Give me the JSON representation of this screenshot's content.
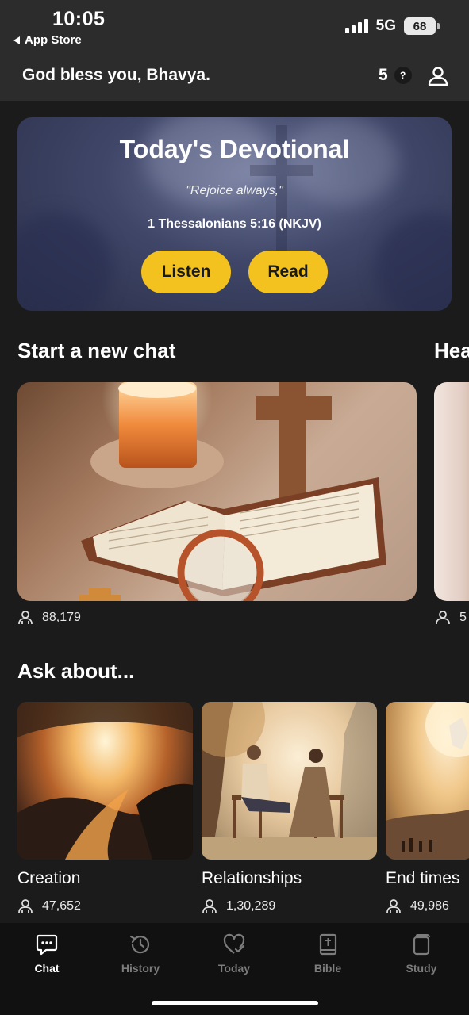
{
  "status_bar": {
    "time": "10:05",
    "back_label": "App Store",
    "network": "5G",
    "battery": "68"
  },
  "header": {
    "greeting": "God bless you, Bhavya.",
    "credits": "5",
    "credits_help": "?",
    "profile_icon": "person-icon"
  },
  "devotional": {
    "title": "Today's Devotional",
    "quote": "\"Rejoice always,\"",
    "reference": "1 Thessalonians 5:16 (NKJV)",
    "listen_label": "Listen",
    "read_label": "Read"
  },
  "start_chat": {
    "title": "Start a new chat",
    "next_title": "Hea",
    "cards": [
      {
        "count": "88,179"
      },
      {
        "count": "5"
      }
    ]
  },
  "ask_about": {
    "title": "Ask about...",
    "items": [
      {
        "label": "Creation",
        "count": "47,652"
      },
      {
        "label": "Relationships",
        "count": "1,30,289"
      },
      {
        "label": "End times",
        "count": "49,986"
      }
    ]
  },
  "nav": {
    "items": [
      {
        "label": "Chat",
        "icon": "chat-bubble-icon",
        "active": true
      },
      {
        "label": "History",
        "icon": "history-icon",
        "active": false
      },
      {
        "label": "Today",
        "icon": "heart-check-icon",
        "active": false
      },
      {
        "label": "Bible",
        "icon": "bible-icon",
        "active": false
      },
      {
        "label": "Study",
        "icon": "study-icon",
        "active": false
      }
    ]
  },
  "colors": {
    "accent_button": "#f3c21f",
    "background": "#1b1b1b",
    "header_bg": "#2c2c2c"
  }
}
